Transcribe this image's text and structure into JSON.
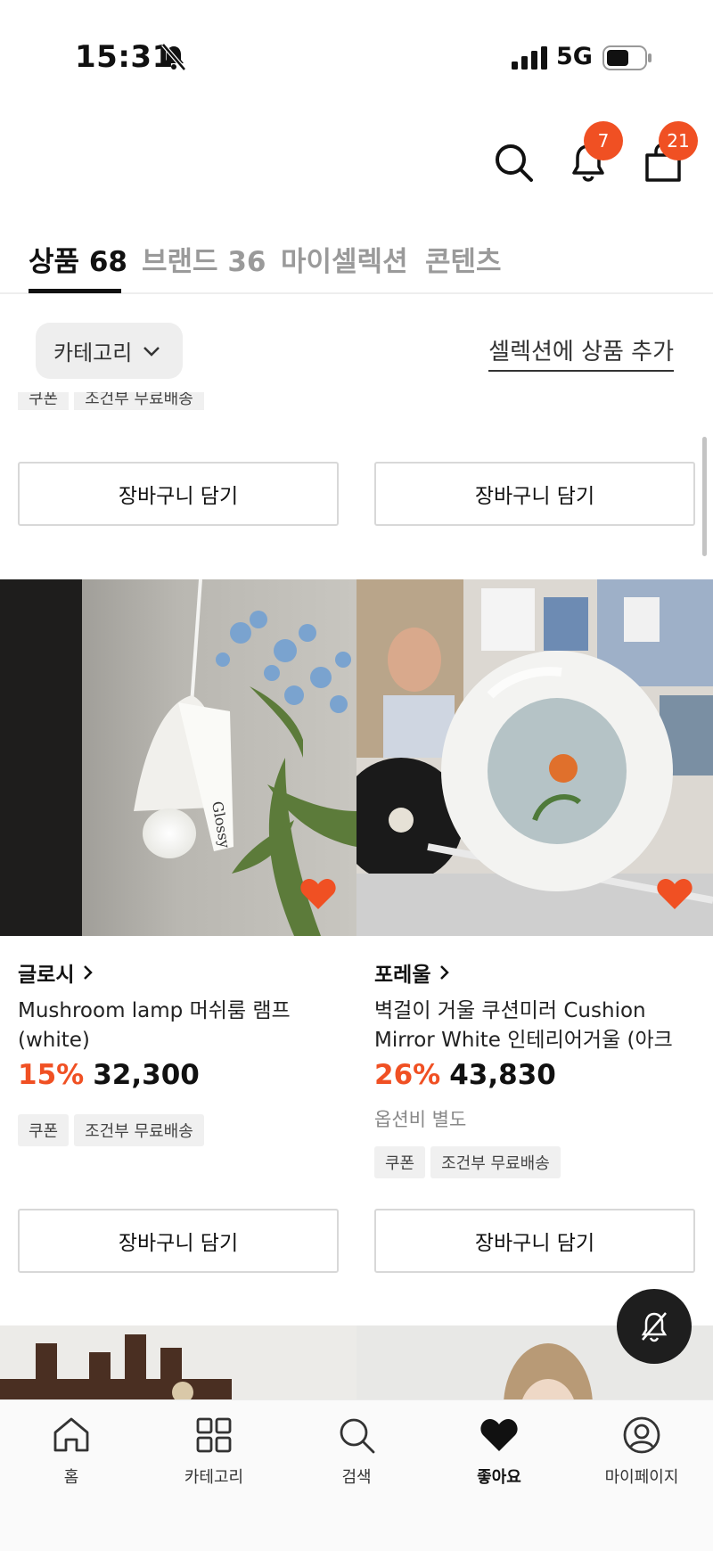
{
  "status_bar": {
    "time": "15:31",
    "network": "5G"
  },
  "header": {
    "notification_count": "7",
    "cart_count": "21"
  },
  "tabs": [
    {
      "label": "상품 68"
    },
    {
      "label": "브랜드 36"
    },
    {
      "label": "마이셀렉션"
    },
    {
      "label": "콘텐츠"
    }
  ],
  "filter": {
    "category_label": "카테고리",
    "add_to_selection": "셀렉션에 상품 추가"
  },
  "prev_row": {
    "tags": [
      "쿠폰",
      "조건부 무료배송"
    ],
    "cart_button": "장바구니 담기"
  },
  "products": [
    {
      "brand": "글로시",
      "name": "Mushroom lamp 머쉬룸 램프 (white)",
      "discount": "15%",
      "price": "32,300",
      "option_note": "",
      "tags": [
        "쿠폰",
        "조건부 무료배송"
      ],
      "cart_button": "장바구니 담기",
      "image_text": "Glossy"
    },
    {
      "brand": "포레울",
      "name": "벽걸이 거울 쿠션미러 Cushion Mirror White 인테리어거울 (아크릴...",
      "discount": "26%",
      "price": "43,830",
      "option_note": "옵션비 별도",
      "tags": [
        "쿠폰",
        "조건부 무료배송"
      ],
      "cart_button": "장바구니 담기"
    }
  ],
  "bottom_nav": [
    {
      "label": "홈",
      "icon": "home-icon"
    },
    {
      "label": "카테고리",
      "icon": "category-grid-icon"
    },
    {
      "label": "검색",
      "icon": "search-icon"
    },
    {
      "label": "좋아요",
      "icon": "heart-icon",
      "active": true
    },
    {
      "label": "마이페이지",
      "icon": "user-circle-icon"
    }
  ],
  "colors": {
    "accent": "#f05023",
    "text": "#111111",
    "muted": "#9a9a9a"
  }
}
